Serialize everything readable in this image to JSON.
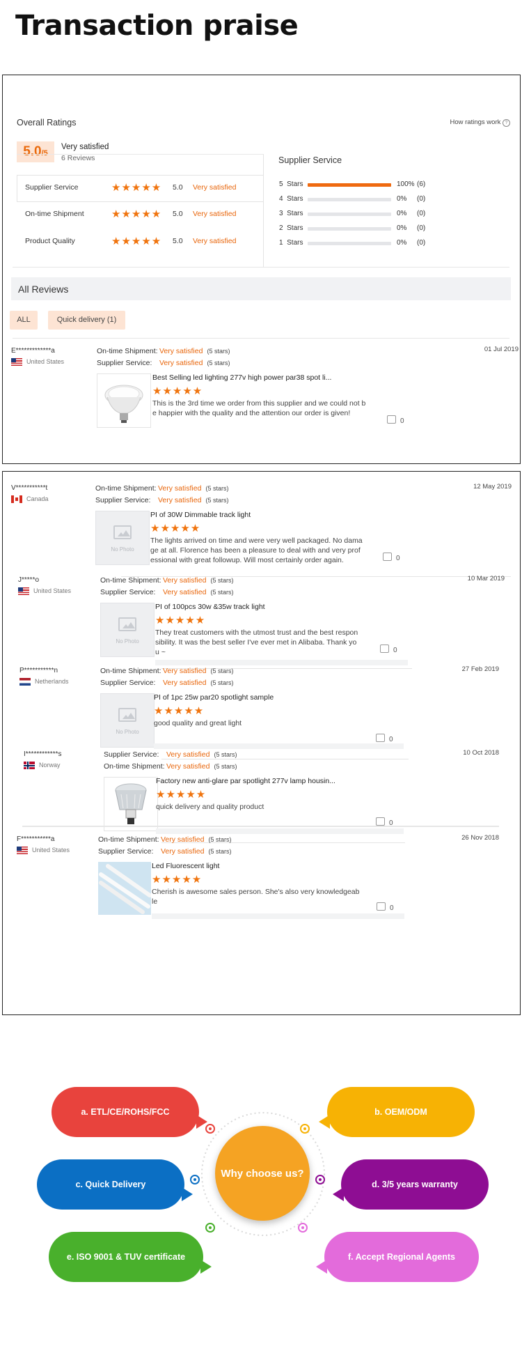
{
  "page_title": "Transaction praise",
  "ratings": {
    "heading": "Overall Ratings",
    "how_link": "How ratings work",
    "score": "5.0",
    "score_suffix": "/5",
    "label": "Very satisfied",
    "count": "6 Reviews",
    "rows": [
      {
        "name": "Supplier Service",
        "value": "5.0",
        "label": "Very satisfied"
      },
      {
        "name": "On-time Shipment",
        "value": "5.0",
        "label": "Very satisfied"
      },
      {
        "name": "Product Quality",
        "value": "5.0",
        "label": "Very satisfied"
      }
    ],
    "breakdown_title": "Supplier Service",
    "breakdown": [
      {
        "label": "5  Stars",
        "pct": "100%",
        "count": "(6)",
        "fraction": 1.0
      },
      {
        "label": "4  Stars",
        "pct": "0%",
        "count": "(0)",
        "fraction": 0
      },
      {
        "label": "3  Stars",
        "pct": "0%",
        "count": "(0)",
        "fraction": 0
      },
      {
        "label": "2  Stars",
        "pct": "0%",
        "count": "(0)",
        "fraction": 0
      },
      {
        "label": "1  Stars",
        "pct": "0%",
        "count": "(0)",
        "fraction": 0
      }
    ]
  },
  "all_reviews": {
    "heading": "All Reviews",
    "filters": [
      "ALL",
      "Quick delivery (1)"
    ]
  },
  "star_glyphs": "★★★★★",
  "reviews": [
    {
      "user": "E*************a",
      "country": "United States",
      "flag": "us",
      "line1_label": "On-time Shipment:",
      "line1_value": "Very satisfied",
      "line1_stars": "(5 stars)",
      "line2_label": "Supplier Service:",
      "line2_value": "Very satisfied",
      "line2_stars": "(5 stars)",
      "date": "01 Jul 2019",
      "title": "Best Selling led lighting 277v high power par38 spot li...",
      "text": "This is the 3rd time we order from this supplier and we could not be happier with the quality and the attention our order is given!",
      "likes": "0",
      "photo": "par-bulb"
    },
    {
      "user": "V***********t",
      "country": "Canada",
      "flag": "ca",
      "line1_label": "On-time Shipment:",
      "line1_value": "Very satisfied",
      "line1_stars": "(5 stars)",
      "line2_label": "Supplier Service:",
      "line2_value": "Very satisfied",
      "line2_stars": "(5 stars)",
      "date": "12 May 2019",
      "title": "PI of 30W Dimmable track light",
      "text": "The lights arrived on time and were very well packaged.  No damage at all. Florence has been a pleasure to deal with and very professional with great followup.  Will most certainly order again.",
      "likes": "0",
      "photo": "none",
      "no_photo": "No Photo"
    },
    {
      "user": "J*****o",
      "country": "United States",
      "flag": "us",
      "line1_label": "On-time Shipment:",
      "line1_value": "Very satisfied",
      "line1_stars": "(5 stars)",
      "line2_label": "Supplier Service:",
      "line2_value": "Very satisfied",
      "line2_stars": "(5 stars)",
      "date": "10 Mar 2019",
      "title": "PI of 100pcs 30w &35w track light",
      "text": "They treat customers with the utmost trust and the best responsibility. It was the best seller I've ever met in Alibaba. Thank you ~",
      "likes": "0",
      "photo": "none",
      "no_photo": "No Photo"
    },
    {
      "user": "P***********n",
      "country": "Netherlands",
      "flag": "nl",
      "line1_label": "On-time Shipment:",
      "line1_value": "Very satisfied",
      "line1_stars": "(5 stars)",
      "line2_label": "Supplier Service:",
      "line2_value": "Very satisfied",
      "line2_stars": "(5 stars)",
      "date": "27 Feb 2019",
      "title": "PI of 1pc 25w par20 spotlight sample",
      "text": "good quality and great light",
      "likes": "0",
      "photo": "none",
      "no_photo": "No Photo"
    },
    {
      "user": "I************s",
      "country": "Norway",
      "flag": "no",
      "line1_label": "Supplier Service:",
      "line1_value": "Very satisfied",
      "line1_stars": "(5 stars)",
      "line2_label": "On-time Shipment:",
      "line2_value": "Very satisfied",
      "line2_stars": "(5 stars)",
      "date": "10 Oct 2018",
      "title": "Factory new anti-glare par spotlight 277v lamp housin...",
      "text": "quick delivery and quality product",
      "likes": "0",
      "photo": "par-lamp"
    },
    {
      "user": "F***********a",
      "country": "United States",
      "flag": "us",
      "line1_label": "On-time Shipment:",
      "line1_value": "Very satisfied",
      "line1_stars": "(5 stars)",
      "line2_label": "Supplier Service:",
      "line2_value": "Very satisfied",
      "line2_stars": "(5 stars)",
      "date": "26 Nov 2018",
      "title": "Led Fluorescent light",
      "text": "Cherish is awesome sales person. She's also very knowledgeable",
      "likes": "0",
      "photo": "tubes"
    }
  ],
  "why": {
    "center": "Why choose us?",
    "items": [
      {
        "label": "a.  ETL/CE/ROHS/FCC",
        "color": "#e8433d"
      },
      {
        "label": "b.  OEM/ODM",
        "color": "#f7b204"
      },
      {
        "label": "c.  Quick Delivery",
        "color": "#0b6fc4"
      },
      {
        "label": "d. 3/5 years warranty",
        "color": "#8e0d93"
      },
      {
        "label": "e.  ISO 9001 & TUV certificate",
        "color": "#49b02c"
      },
      {
        "label": "f.  Accept Regional Agents",
        "color": "#e36bdb"
      }
    ],
    "center_color": "#f5a323"
  }
}
